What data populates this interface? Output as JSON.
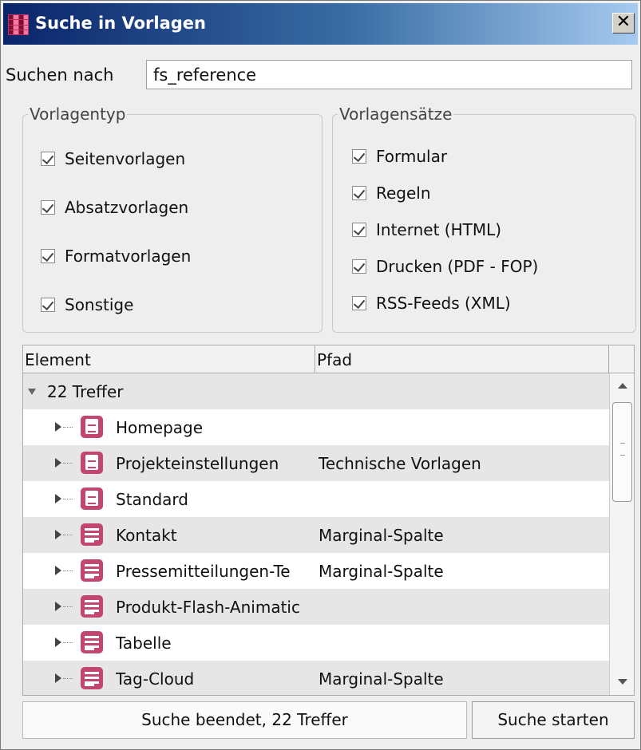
{
  "window": {
    "title": "Suche in Vorlagen",
    "close_label": "✕"
  },
  "search": {
    "label": "Suchen nach",
    "value": "fs_reference"
  },
  "template_type": {
    "title": "Vorlagentyp",
    "items": [
      {
        "label": "Seitenvorlagen",
        "checked": true
      },
      {
        "label": "Absatzvorlagen",
        "checked": true
      },
      {
        "label": "Formatvorlagen",
        "checked": true
      },
      {
        "label": "Sonstige",
        "checked": true
      }
    ]
  },
  "template_sets": {
    "title": "Vorlagensätze",
    "items": [
      {
        "label": "Formular",
        "checked": true
      },
      {
        "label": "Regeln",
        "checked": true
      },
      {
        "label": "Internet (HTML)",
        "checked": true
      },
      {
        "label": "Drucken (PDF - FOP)",
        "checked": true
      },
      {
        "label": "RSS-Feeds (XML)",
        "checked": true
      }
    ]
  },
  "results": {
    "columns": [
      "Element",
      "Pfad"
    ],
    "group_label": "22 Treffer",
    "rows": [
      {
        "name": "Homepage",
        "path": "",
        "icon": "page-template-icon"
      },
      {
        "name": "Projekteinstellungen",
        "path": "Technische Vorlagen",
        "icon": "page-template-icon"
      },
      {
        "name": "Standard",
        "path": "",
        "icon": "page-template-icon"
      },
      {
        "name": "Kontakt",
        "path": "Marginal-Spalte",
        "icon": "section-template-icon"
      },
      {
        "name": "Pressemitteilungen-Te",
        "path": "Marginal-Spalte",
        "icon": "section-template-icon"
      },
      {
        "name": "Produkt-Flash-Animatic",
        "path": "",
        "icon": "section-template-icon"
      },
      {
        "name": "Tabelle",
        "path": "",
        "icon": "section-template-icon"
      },
      {
        "name": "Tag-Cloud",
        "path": "Marginal-Spalte",
        "icon": "section-template-icon"
      }
    ]
  },
  "footer": {
    "status": "Suche beendet, 22 Treffer",
    "start_button": "Suche starten"
  }
}
